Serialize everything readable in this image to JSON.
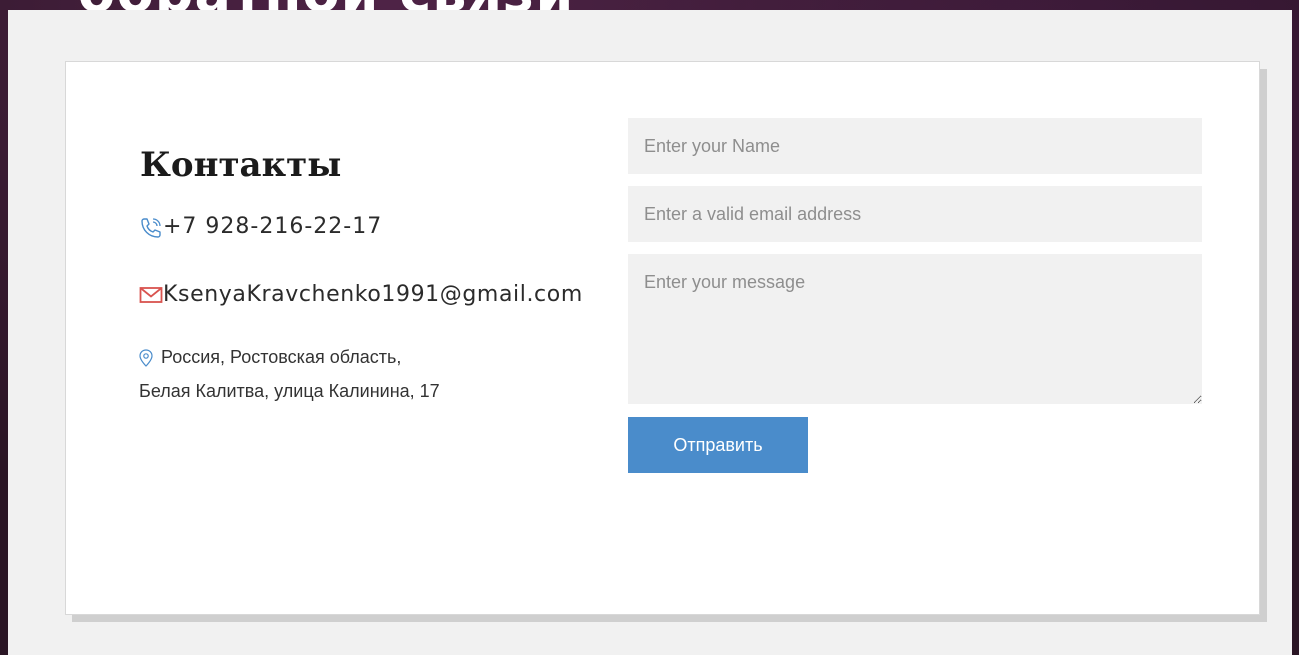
{
  "background_heading": "обратной связи",
  "contacts": {
    "title": "Контакты",
    "phone": "+7 928-216-22-17",
    "email": "KsenyaKravchenko1991@gmail.com",
    "address_line1": "Россия, Ростовская область,",
    "address_line2": "Белая Калитва, улица Калинина, 17",
    "icons": {
      "phone": "phone-icon",
      "email": "mail-icon",
      "address": "map-pin-icon"
    }
  },
  "form": {
    "name_placeholder": "Enter your Name",
    "email_placeholder": "Enter a valid email address",
    "message_placeholder": "Enter your message",
    "submit_label": "Отправить"
  },
  "colors": {
    "accent": "#4a8ccb",
    "mail_icon": "#d9534f",
    "phone_icon": "#4a8ccb",
    "field_bg": "#f1f1f1"
  }
}
